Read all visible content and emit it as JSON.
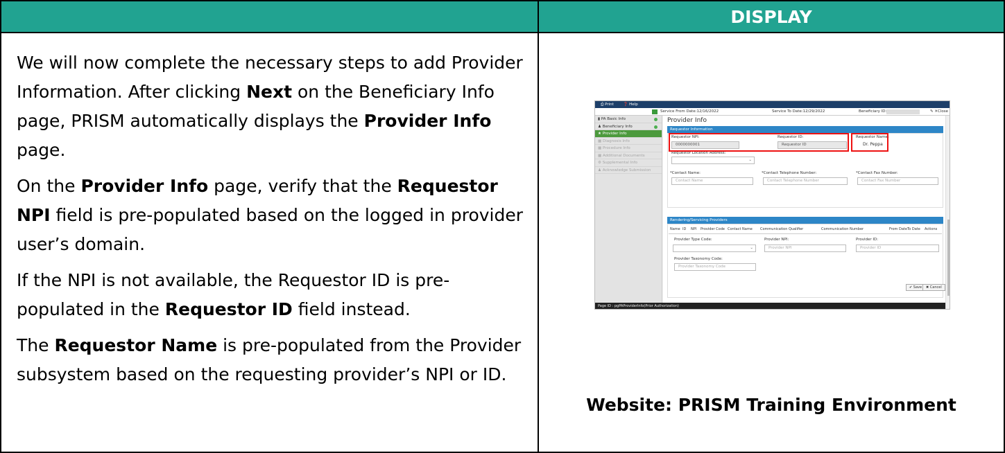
{
  "header": {
    "left_label": "",
    "right_label": "DISPLAY"
  },
  "instructions": {
    "p1": {
      "t1": "We will now complete the necessary steps to add Provider Information. After clicking ",
      "b1": "Next",
      "t2": " on the Beneficiary Info page, PRISM automatically displays the ",
      "b2": "Provider Info",
      "t3": " page."
    },
    "p2": {
      "t1": "On the ",
      "b1": "Provider Info",
      "t2": " page, verify that the ",
      "b2": "Requestor NPI",
      "t3": " field is pre-populated based on the logged in provider user’s domain."
    },
    "p3": {
      "t1": "If the NPI is not available, the Requestor ID is pre-populated in the ",
      "b1": "Requestor ID",
      "t2": " field instead."
    },
    "p4": {
      "t1": "The ",
      "b1": "Requestor Name",
      "t2": " is pre-populated from the Provider subsystem based on the requesting provider’s NPI or ID."
    }
  },
  "caption": "Website: PRISM Training Environment",
  "screenshot": {
    "topbar": {
      "print": "Print",
      "help": "Help"
    },
    "service_bar": {
      "from": "Service From Date:12/16/2022",
      "to": "Service To Date:12/29/2022",
      "beneficiary": "Beneficiary ID:",
      "close": "Close"
    },
    "sidebar": [
      {
        "label": "PA Basic Info",
        "state": "done"
      },
      {
        "label": "Beneficiary Info",
        "state": "done"
      },
      {
        "label": "Provider Info",
        "state": "active"
      },
      {
        "label": "Diagnosis Info",
        "state": "disabled"
      },
      {
        "label": "Procedure Info",
        "state": "disabled"
      },
      {
        "label": "Additional Documents",
        "state": "disabled"
      },
      {
        "label": "Supplemental Info",
        "state": "disabled"
      },
      {
        "label": "Acknowledge Submission",
        "state": "disabled"
      }
    ],
    "page_title": "Provider Info",
    "requestor": {
      "section": "Requestor Information",
      "npi_label": "Requestor NPI:",
      "npi_value": "0000000001",
      "id_label": "Requestor ID:",
      "id_placeholder": "Requestor ID",
      "name_label": "Requestor Name:",
      "name_value": "Dr. Peppa",
      "location_label": "Requestor Location Address:",
      "contact_name_label": "*Contact Name:",
      "contact_name_placeholder": "Contact Name",
      "contact_phone_label": "*Contact Telephone Number:",
      "contact_phone_placeholder": "Contact Telephone Number",
      "contact_fax_label": "*Contact Fax Number:",
      "contact_fax_placeholder": "Contact Fax Number"
    },
    "rendering": {
      "section": "Rendering/Servicing Providers",
      "columns": [
        "Name",
        "ID",
        "NPI",
        "Provider Code",
        "Contact Name",
        "Communication Qualifier",
        "Communication Number",
        "From Date",
        "To Date",
        "Actions"
      ],
      "type_code_label": "Provider Type Code:",
      "npi_label": "Provider NPI:",
      "npi_placeholder": "Provider NPI",
      "id_label": "Provider ID:",
      "id_placeholder": "Provider ID",
      "taxonomy_label": "Provider Taxonomy Code:",
      "taxonomy_placeholder": "Provider Taxonomy Code",
      "save": "Save",
      "cancel": "Cancel"
    },
    "footer": "Page ID : pgPAProviderInfo(Prior Authorization)"
  }
}
